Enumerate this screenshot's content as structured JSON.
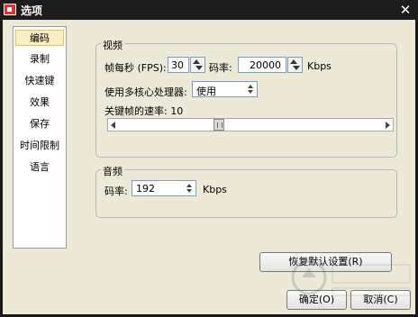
{
  "window": {
    "title": "选项",
    "close_glyph": "✕"
  },
  "sidebar": {
    "items": [
      {
        "label": "编码",
        "active": true
      },
      {
        "label": "录制"
      },
      {
        "label": "快速键"
      },
      {
        "label": "效果"
      },
      {
        "label": "保存"
      },
      {
        "label": "时间限制"
      },
      {
        "label": "语言"
      }
    ]
  },
  "video": {
    "group_title": "视频",
    "fps_label": "帧每秒 (FPS):",
    "fps_value": "30",
    "bitrate_label": "码率:",
    "bitrate_value": "20000",
    "bitrate_unit": "Kbps",
    "multicore_label": "使用多核心处理器:",
    "multicore_value": "使用",
    "keyframe_label": "关键帧的速率: 10",
    "keyframe_slider_level": 0.37
  },
  "audio": {
    "group_title": "音频",
    "bitrate_label": "码率:",
    "bitrate_value": "192",
    "bitrate_unit": "Kbps"
  },
  "buttons": {
    "restore_defaults": "恢复默认设置(R)",
    "ok": "确定(O)",
    "cancel": "取消(C)"
  },
  "icons": {
    "app": "app-icon",
    "spin": "spin-icon"
  }
}
